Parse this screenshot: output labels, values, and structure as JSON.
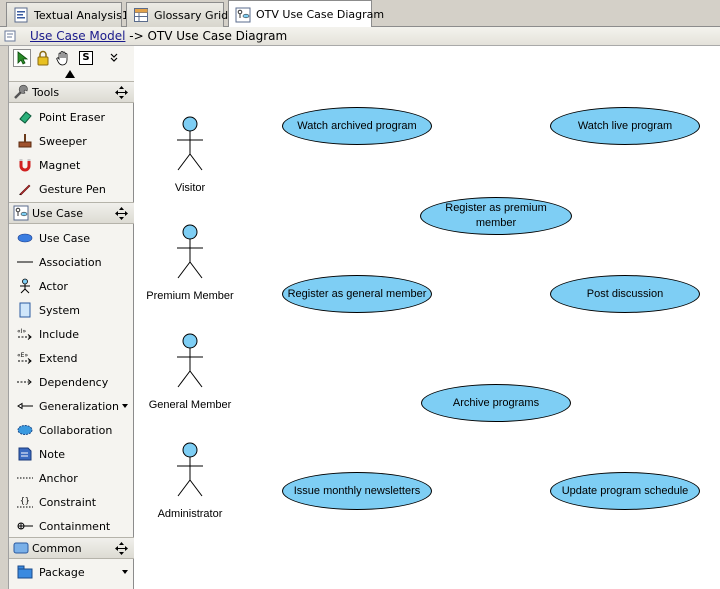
{
  "tabs": [
    {
      "label": "Textual Analysis1",
      "icon": "textual-analysis-icon"
    },
    {
      "label": "Glossary Grid",
      "icon": "glossary-grid-icon"
    },
    {
      "label": "OTV Use Case Diagram",
      "icon": "use-case-diagram-icon",
      "active": true
    }
  ],
  "breadcrumb": {
    "link": "Use Case Model",
    "rest": " -> OTV Use Case Diagram"
  },
  "palette": {
    "selection_tools": [
      "selector",
      "lock",
      "hand",
      "sweeper-s",
      "more"
    ],
    "groups": [
      {
        "label": "Tools",
        "items": [
          "Point Eraser",
          "Sweeper",
          "Magnet",
          "Gesture Pen"
        ]
      },
      {
        "label": "Use Case",
        "items": [
          "Use Case",
          "Association",
          "Actor",
          "System",
          "Include",
          "Extend",
          "Dependency",
          "Generalization",
          "Collaboration",
          "Note",
          "Anchor",
          "Constraint",
          "Containment"
        ]
      },
      {
        "label": "Common",
        "items": [
          "Package"
        ]
      }
    ]
  },
  "diagram": {
    "colors": {
      "usecase_fill": "#7ecef4",
      "actor_fill": "#7ecef4",
      "line": "#000000"
    },
    "actors": [
      "Visitor",
      "Premium Member",
      "General Member",
      "Administrator"
    ],
    "use_cases": [
      "Watch archived program",
      "Watch live program",
      "Register as premium member",
      "Register as general member",
      "Post discussion",
      "Archive programs",
      "Issue monthly newsletters",
      "Update program schedule"
    ]
  }
}
